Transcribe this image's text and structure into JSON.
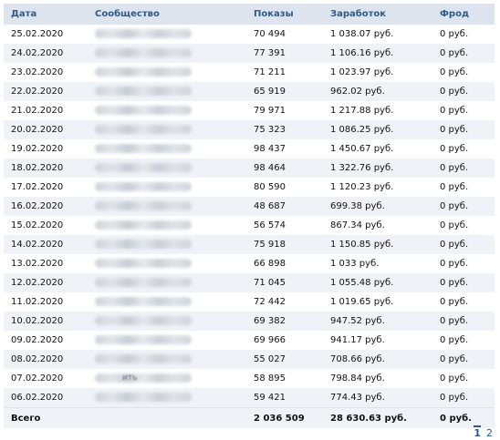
{
  "table": {
    "headers": {
      "date": "Дата",
      "community": "Сообщество",
      "views": "Показы",
      "earnings": "Заработок",
      "fraud": "Фрод"
    },
    "rows": [
      {
        "date": "25.02.2020",
        "views": "70 494",
        "earnings": "1 038.07 руб.",
        "fraud": "0 руб."
      },
      {
        "date": "24.02.2020",
        "views": "77 391",
        "earnings": "1 106.16 руб.",
        "fraud": "0 руб."
      },
      {
        "date": "23.02.2020",
        "views": "71 211",
        "earnings": "1 023.97 руб.",
        "fraud": "0 руб."
      },
      {
        "date": "22.02.2020",
        "views": "65 919",
        "earnings": "962.02 руб.",
        "fraud": "0 руб."
      },
      {
        "date": "21.02.2020",
        "views": "79 971",
        "earnings": "1 217.88 руб.",
        "fraud": "0 руб."
      },
      {
        "date": "20.02.2020",
        "views": "75 323",
        "earnings": "1 086.25 руб.",
        "fraud": "0 руб."
      },
      {
        "date": "19.02.2020",
        "views": "98 437",
        "earnings": "1 450.67 руб.",
        "fraud": "0 руб."
      },
      {
        "date": "18.02.2020",
        "views": "98 464",
        "earnings": "1 322.76 руб.",
        "fraud": "0 руб."
      },
      {
        "date": "17.02.2020",
        "views": "80 590",
        "earnings": "1 120.23 руб.",
        "fraud": "0 руб."
      },
      {
        "date": "16.02.2020",
        "views": "48 687",
        "earnings": "699.38 руб.",
        "fraud": "0 руб."
      },
      {
        "date": "15.02.2020",
        "views": "56 574",
        "earnings": "867.34 руб.",
        "fraud": "0 руб."
      },
      {
        "date": "14.02.2020",
        "views": "75 918",
        "earnings": "1 150.85 руб.",
        "fraud": "0 руб."
      },
      {
        "date": "13.02.2020",
        "views": "66 898",
        "earnings": "1 033 руб.",
        "fraud": "0 руб."
      },
      {
        "date": "12.02.2020",
        "views": "71 045",
        "earnings": "1 055.48 руб.",
        "fraud": "0 руб."
      },
      {
        "date": "11.02.2020",
        "views": "72 442",
        "earnings": "1 019.65 руб.",
        "fraud": "0 руб."
      },
      {
        "date": "10.02.2020",
        "views": "69 382",
        "earnings": "947.52 руб.",
        "fraud": "0 руб."
      },
      {
        "date": "09.02.2020",
        "views": "69 966",
        "earnings": "941.17 руб.",
        "fraud": "0 руб."
      },
      {
        "date": "08.02.2020",
        "views": "55 027",
        "earnings": "708.66 руб.",
        "fraud": "0 руб."
      },
      {
        "date": "07.02.2020",
        "views": "58 895",
        "earnings": "798.84 руб.",
        "fraud": "0 руб.",
        "community_peek": "ить"
      },
      {
        "date": "06.02.2020",
        "views": "59 421",
        "earnings": "774.43 руб.",
        "fraud": "0 руб."
      }
    ],
    "total": {
      "label": "Всего",
      "views": "2 036 509",
      "earnings": "28 630.63 руб.",
      "fraud": "0 руб."
    }
  },
  "pagination": {
    "pages": [
      "1",
      "2"
    ],
    "current": "1"
  },
  "colors": {
    "header_bg": "#dde4ed",
    "header_text": "#2b5b8e",
    "row_alt_bg": "#eff2f6",
    "link": "#2b5b8e"
  }
}
